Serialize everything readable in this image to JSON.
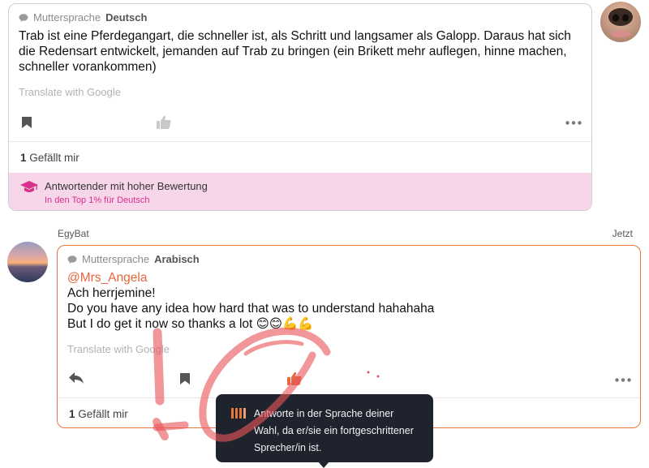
{
  "post1": {
    "native_label": "Muttersprache",
    "native_language": "Deutsch",
    "text": "Trab ist eine Pferdegangart, die schneller ist, als Schritt und langsamer als Galopp. Daraus hat sich die Redensart entwickelt, jemanden auf Trab zu bringen (ein Brikett mehr auflegen, hinne machen, schneller vorankommen)",
    "translate_label": "Translate with Google",
    "like_count": "1",
    "like_label": "Gefällt mir",
    "badge_title": "Antwortender mit hoher Bewertung",
    "badge_subtitle": "In den Top 1% für Deutsch",
    "icons": [
      "bookmark-icon",
      "thumbs-up-icon",
      "more-icon",
      "graduation-cap-icon",
      "speech-bubble-icon"
    ]
  },
  "post2": {
    "username": "EgyBat",
    "timestamp": "Jetzt",
    "native_label": "Muttersprache",
    "native_language": "Arabisch",
    "mention": "@Mrs_Angela",
    "lines": [
      "Ach herrjemine!",
      "Do you have any idea how hard that was to understand hahahaha",
      "But I do get it now so thanks a lot 😊😊💪💪"
    ],
    "translate_label": "Translate with Google",
    "like_count": "1",
    "like_label": "Gefällt mir",
    "icons": [
      "reply-icon",
      "bookmark-icon",
      "thumbs-up-icon",
      "more-icon"
    ]
  },
  "tooltip": {
    "text": "Antworte in der Sprache deiner Wahl, da er/sie ein fortgeschrittener Sprecher/in ist.",
    "icon": "proficiency-bars-icon"
  },
  "colors": {
    "accent": "#e8773c",
    "badge_bg": "#f8d6ea",
    "badge_text": "#d9308c",
    "tooltip_bg": "#1e232d",
    "scribble": "#e8555a"
  }
}
